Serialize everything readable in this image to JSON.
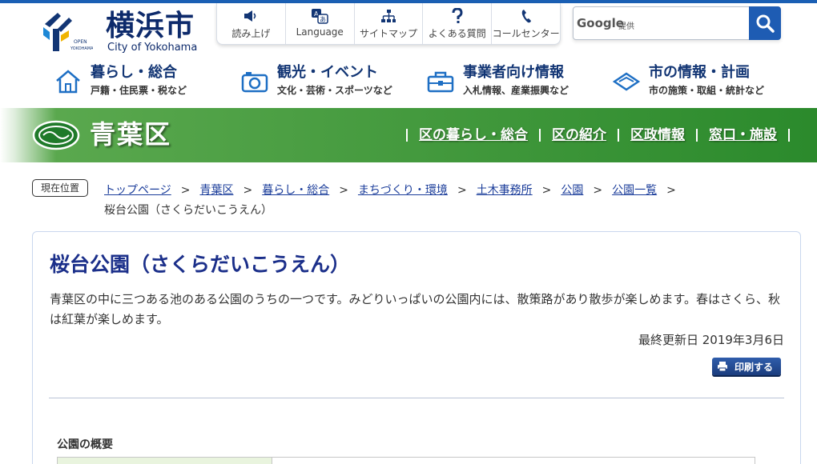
{
  "site": {
    "logo_jp": "横浜市",
    "logo_en": "City of Yokohama",
    "logo_badge": "OPEN YOKOHAMA"
  },
  "util_nav": [
    {
      "label": "読み上げ",
      "icon": "speaker-icon"
    },
    {
      "label": "Language",
      "icon": "language-icon"
    },
    {
      "label": "サイトマップ",
      "icon": "sitemap-icon"
    },
    {
      "label": "よくある質問",
      "icon": "question-icon"
    },
    {
      "label": "コールセンター",
      "icon": "phone-icon"
    }
  ],
  "search": {
    "brand": "Google",
    "provided": "提供",
    "placeholder": ""
  },
  "global_nav": [
    {
      "title": "暮らし・総合",
      "sub": "戸籍・住民票・税など",
      "icon": "house-icon"
    },
    {
      "title": "観光・イベント",
      "sub": "文化・芸術・スポーツなど",
      "icon": "camera-icon"
    },
    {
      "title": "事業者向け情報",
      "sub": "入札情報、産業振興など",
      "icon": "toolbox-icon"
    },
    {
      "title": "市の情報・計画",
      "sub": "市の施策・取組・統計など",
      "icon": "city-emblem-icon"
    }
  ],
  "ward": {
    "name": "青葉区",
    "links": [
      "区の暮らし・総合",
      "区の紹介",
      "区政情報",
      "窓口・施設"
    ]
  },
  "breadcrumb": {
    "tag": "現在位置",
    "items": [
      "トップページ",
      "青葉区",
      "暮らし・総合",
      "まちづくり・環境",
      "土木事務所",
      "公園",
      "公園一覧"
    ],
    "separator": ">",
    "current": "桜台公園（さくらだいこうえん）"
  },
  "article": {
    "title": "桜台公園（さくらだいこうえん）",
    "description": "青葉区の中に三つある池のある公園のうちの一つです。みどりいっぱいの公園内には、散策路があり散歩が楽しめます。春はさくら、秋は紅葉が楽しめます。",
    "updated": "最終更新日 2019年3月6日",
    "print_label": "印刷する",
    "section_title": "公園の概要"
  },
  "colors": {
    "brand_navy": "#123574",
    "ward_green": "#2b8a2c",
    "link_blue": "#1a3c9a",
    "title_blue": "#1b2f8a",
    "search_blue": "#1e5cb3"
  }
}
